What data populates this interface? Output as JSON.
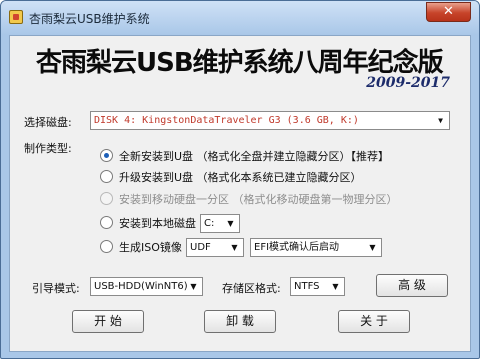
{
  "window": {
    "title": "杏雨梨云USB维护系统",
    "close_label": "✕"
  },
  "banner": {
    "title": "杏雨梨云USB维护系统八周年纪念版",
    "years": "2009-2017"
  },
  "disk": {
    "label": "选择磁盘:",
    "value": "DISK 4: KingstonDataTraveler G3 (3.6 GB, K:)"
  },
  "make_type": {
    "label": "制作类型:",
    "options": [
      {
        "text": "全新安装到U盘  （格式化全盘并建立隐藏分区）【推荐】",
        "checked": true,
        "disabled": false
      },
      {
        "text": "升级安装到U盘  （格式化本系统已建立隐藏分区）",
        "checked": false,
        "disabled": false
      },
      {
        "text": "安装到移动硬盘一分区  （格式化移动硬盘第一物理分区）",
        "checked": false,
        "disabled": true
      },
      {
        "text": "安装到本地磁盘",
        "checked": false,
        "disabled": false
      },
      {
        "text": "生成ISO镜像",
        "checked": false,
        "disabled": false
      }
    ],
    "local_disk_value": "C:",
    "iso_format_value": "UDF",
    "iso_boot_value": "EFI模式确认后启动"
  },
  "boot_mode": {
    "label": "引导模式:",
    "value": "USB-HDD(WinNT6)"
  },
  "storage_format": {
    "label": "存储区格式:",
    "value": "NTFS"
  },
  "buttons": {
    "advanced": "高 级",
    "start": "开 始",
    "uninstall": "卸 载",
    "about": "关 于"
  }
}
